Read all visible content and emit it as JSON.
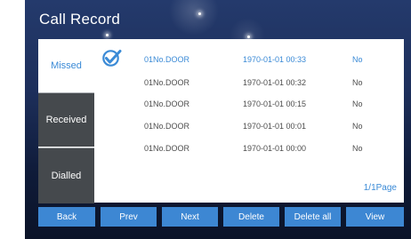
{
  "header": {
    "title": "Call Record"
  },
  "sidebar": {
    "tabs": [
      {
        "label": "Missed",
        "active": true
      },
      {
        "label": "Received",
        "active": false
      },
      {
        "label": "Dialled",
        "active": false
      }
    ]
  },
  "records": [
    {
      "door": "01No.DOOR",
      "time": "1970-01-01  00:33",
      "flag": "No",
      "selected": true
    },
    {
      "door": "01No.DOOR",
      "time": "1970-01-01  00:32",
      "flag": "No",
      "selected": false
    },
    {
      "door": "01No.DOOR",
      "time": "1970-01-01  00:15",
      "flag": "No",
      "selected": false
    },
    {
      "door": "01No.DOOR",
      "time": "1970-01-01  00:01",
      "flag": "No",
      "selected": false
    },
    {
      "door": "01No.DOOR",
      "time": "1970-01-01  00:00",
      "flag": "No",
      "selected": false
    }
  ],
  "pagination": {
    "label": "1/1Page"
  },
  "buttons": {
    "back": "Back",
    "prev": "Prev",
    "next": "Next",
    "delete": "Delete",
    "delete_all": "Delete all",
    "view": "View"
  },
  "colors": {
    "accent": "#3d87d3",
    "selected_text": "#3a8ad6",
    "inactive_tab": "#45494d",
    "background_top": "#243a6c",
    "background_bottom": "#0b1328"
  },
  "icons": {
    "selection": "check-circle-icon"
  }
}
